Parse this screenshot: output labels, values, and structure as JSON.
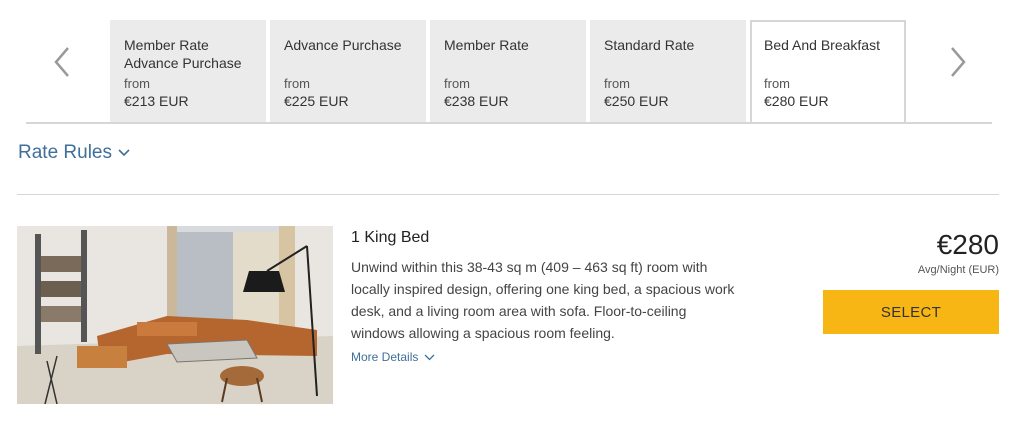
{
  "tabs": [
    {
      "name": "Member Rate Advance Purchase",
      "from": "from",
      "price": "€213 EUR",
      "active": false
    },
    {
      "name": "Advance Purchase",
      "from": "from",
      "price": "€225 EUR",
      "active": false
    },
    {
      "name": "Member Rate",
      "from": "from",
      "price": "€238 EUR",
      "active": false
    },
    {
      "name": "Standard Rate",
      "from": "from",
      "price": "€250 EUR",
      "active": false
    },
    {
      "name": "Bed And Breakfast",
      "from": "from",
      "price": "€280 EUR",
      "active": true
    }
  ],
  "nav": {
    "prev_icon": "chevron-left-icon",
    "next_icon": "chevron-right-icon"
  },
  "rate_rules": {
    "label": "Rate Rules",
    "icon": "chevron-down-icon"
  },
  "room": {
    "title": "1 King Bed",
    "description": "Unwind within this 38-43 sq m (409 – 463 sq ft) room with locally inspired design, offering one king bed, a spacious work desk, and a living room area with sofa. Floor-to-ceiling windows allowing a spacious room feeling.",
    "more_details": "More Details",
    "price": "€280",
    "price_unit": "Avg/Night (EUR)",
    "select_label": "SELECT"
  },
  "colors": {
    "accent": "#f7b614",
    "link": "#3f6f9a",
    "tab_bg": "#ebebeb"
  }
}
